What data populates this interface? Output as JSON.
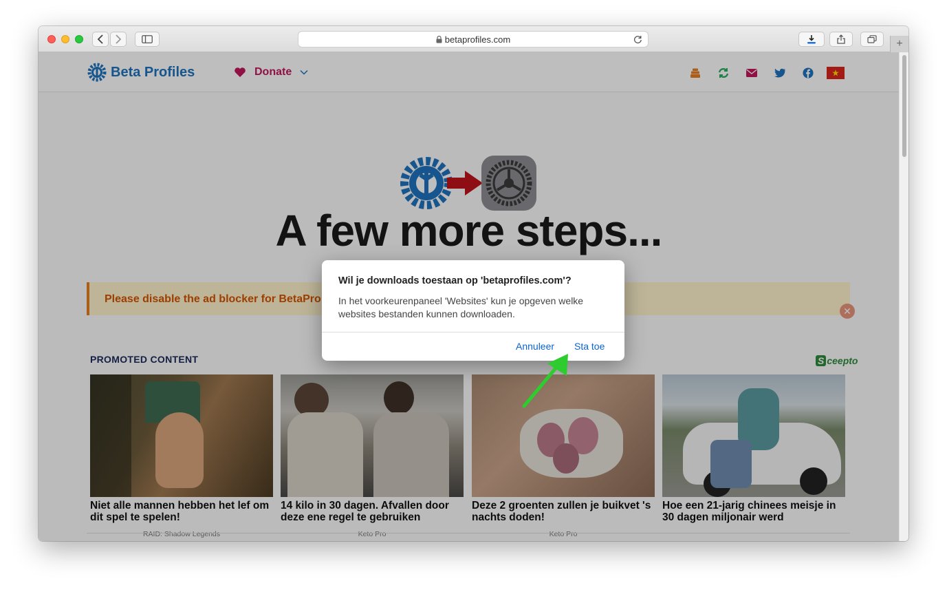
{
  "browser": {
    "url": "betaprofiles.com",
    "colors": {
      "close": "#ff5f57",
      "minimize": "#febc2e",
      "maximize": "#28c840",
      "download_bar": "#1e6fe0"
    }
  },
  "site": {
    "logo_text": "Beta Profiles",
    "donate_label": "Donate",
    "hero_heading": "A few more steps...",
    "adblock_notice": "Please disable the ad blocker for BetaPro",
    "promoted_label": "PROMOTED CONTENT",
    "promo_brand": "Sceepto",
    "cards": [
      {
        "title": "Niet alle mannen hebben het lef om dit spel te spelen!",
        "source": "RAID: Shadow Legends"
      },
      {
        "title": "14 kilo in 30 dagen. Afvallen door deze ene regel te gebruiken",
        "source": "Keto Pro"
      },
      {
        "title": "Deze 2 groenten zullen je buikvet 's nachts doden!",
        "source": "Keto Pro"
      },
      {
        "title": "Hoe een 21-jarig chinees meisje in 30 dagen miljonair werd",
        "source": ""
      }
    ]
  },
  "dialog": {
    "title": "Wil je downloads toestaan op 'betaprofiles.com'?",
    "body": "In het voorkeurenpaneel 'Websites' kun je opgeven welke websites bestanden kunnen downloaden.",
    "cancel_label": "Annuleer",
    "allow_label": "Sta toe"
  },
  "annotation": {
    "arrow_color": "#2ecc2e"
  }
}
